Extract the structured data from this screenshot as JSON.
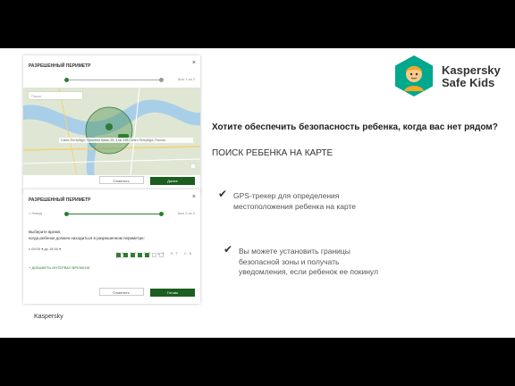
{
  "brand": {
    "line1": "Kaspersky",
    "line2": "Safe Kids",
    "colors": {
      "green": "#2e7d32",
      "teal": "#00a88e",
      "orange": "#f5a623"
    }
  },
  "headline": "Хотите обеспечить безопасность ребенка, когда вас нет рядом?",
  "subhead": "ПОИСК РЕБЕНКА НА КАРТЕ",
  "features": [
    {
      "text": "GPS-трекер для определения местоположения ребенка на карте"
    },
    {
      "text": "Вы можете установить границы безопасной зоны и получать уведомления, если ребенок ее покинул"
    }
  ],
  "footer": "Kaspersky",
  "screen1": {
    "title": "РАЗРЕШЕННЫЙ ПЕРИМЕТР",
    "close": "×",
    "step_label": "Шаг 1 из 2",
    "search_placeholder": "Поиск",
    "address": "Санкт-Петербург, Проспект Кима, 25, 3 кв. 195 Санкт-Петербург, Россия",
    "buttons": {
      "cancel": "Отменить",
      "next": "Далее"
    }
  },
  "screen2": {
    "title": "РАЗРЕШЕННЫЙ ПЕРИМЕТР",
    "close": "×",
    "back": "< Назад",
    "step_label": "Шаг 2 из 2",
    "prompt_line1": "Выберите время,",
    "prompt_line2": "когда ребенок должен находиться в разрешенном периметре:",
    "times": "с  09:00  ▾   до  18:00  ▾",
    "day_labels": "ПН ВТ СР ЧТ ПТ СБ ВС",
    "add_interval": "+ ДОБАВИТЬ ИНТЕРВАЛ ВРЕМЕНИ",
    "buttons": {
      "cancel": "Отменить",
      "done": "Готово"
    }
  }
}
